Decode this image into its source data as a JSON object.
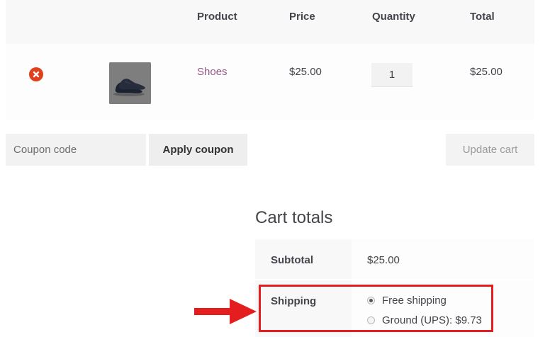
{
  "cart": {
    "headers": {
      "product": "Product",
      "price": "Price",
      "quantity": "Quantity",
      "total": "Total"
    },
    "items": [
      {
        "name": "Shoes",
        "price": "$25.00",
        "quantity": "1",
        "total": "$25.00"
      }
    ]
  },
  "coupon": {
    "placeholder": "Coupon code",
    "apply_label": "Apply coupon"
  },
  "update_label": "Update cart",
  "totals": {
    "title": "Cart totals",
    "subtotal_label": "Subtotal",
    "subtotal_value": "$25.00",
    "shipping_label": "Shipping",
    "shipping_options": [
      {
        "label": "Free shipping",
        "selected": true
      },
      {
        "label": "Ground (UPS): $9.73",
        "selected": false
      }
    ]
  },
  "colors": {
    "accent": "#96588a",
    "remove": "#e2401c",
    "annotation": "#e41e1e"
  },
  "icons": {
    "remove": "remove-x-circle-icon",
    "annotation_arrow": "red-arrow-icon"
  }
}
